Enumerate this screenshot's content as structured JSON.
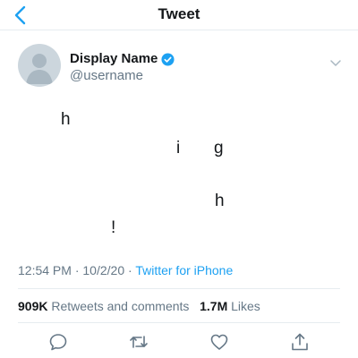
{
  "header": {
    "title": "Tweet",
    "back_icon": "chevron-left-icon"
  },
  "author": {
    "display_name": "Display Name",
    "handle": "@username",
    "verified": true,
    "verified_icon": "verified-badge-icon",
    "avatar_icon": "avatar-placeholder-icon"
  },
  "tweet": {
    "characters": [
      "h",
      "i",
      "g",
      "h",
      "!"
    ],
    "time": "12:54 PM",
    "separator": " · ",
    "date": "10/2/20",
    "source_separator": " · ",
    "source": "Twitter for iPhone"
  },
  "stats": {
    "retweets_count": "909K",
    "retweets_label": "Retweets and comments",
    "likes_count": "1.7M",
    "likes_label": "Likes"
  },
  "actions": [
    {
      "name": "reply",
      "icon": "reply-icon"
    },
    {
      "name": "retweet",
      "icon": "retweet-icon"
    },
    {
      "name": "like",
      "icon": "heart-icon"
    },
    {
      "name": "share",
      "icon": "share-icon"
    }
  ],
  "colors": {
    "accent": "#1da1f2",
    "text_primary": "#14171a",
    "text_secondary": "#657786",
    "divider": "#e6ecf0"
  }
}
